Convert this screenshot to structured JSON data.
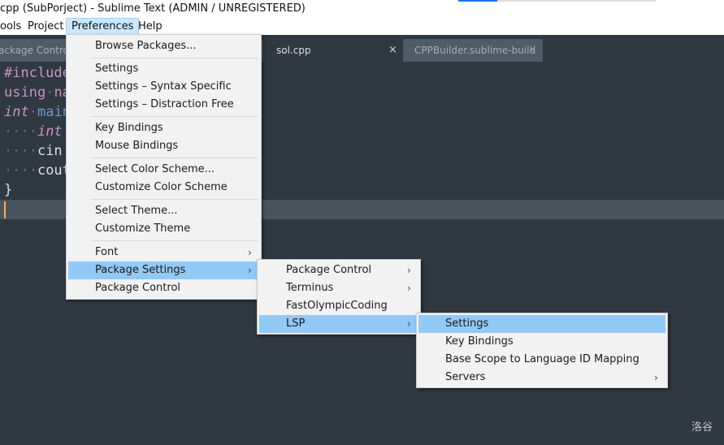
{
  "window": {
    "title": "cpp (SubPorject) - Sublime Text (ADMIN / UNREGISTERED)"
  },
  "menubar": {
    "items": [
      "ools",
      "Project",
      "Preferences",
      "Help"
    ]
  },
  "tabs": [
    {
      "label": "ackage Control M",
      "active": false
    },
    {
      "label": "sol.cpp",
      "active": true,
      "close": "×"
    },
    {
      "label": "CPPBuilder.sublime-build",
      "active": false,
      "close": "×"
    }
  ],
  "editor": {
    "lines": [
      {
        "parts": [
          {
            "t": "#include",
            "c": "kw-preproc"
          }
        ]
      },
      {
        "parts": [
          {
            "t": "using",
            "c": "kw"
          },
          {
            "t": "·",
            "c": "ws-dots"
          },
          {
            "t": "na",
            "c": "kw"
          }
        ]
      },
      {
        "parts": [
          {
            "t": "int",
            "c": "type-italic"
          },
          {
            "t": "·",
            "c": "ws-dots"
          },
          {
            "t": "main",
            "c": "func"
          }
        ]
      },
      {
        "parts": [
          {
            "t": "····",
            "c": "ws-dots"
          },
          {
            "t": "int",
            "c": "type-italic"
          }
        ]
      },
      {
        "parts": [
          {
            "t": "····",
            "c": "ws-dots"
          },
          {
            "t": "cin",
            "c": "ident"
          }
        ]
      },
      {
        "parts": [
          {
            "t": "····",
            "c": "ws-dots"
          },
          {
            "t": "cout",
            "c": "ident"
          }
        ]
      },
      {
        "parts": [
          {
            "t": "}",
            "c": "brace"
          }
        ]
      },
      {
        "parts": []
      }
    ]
  },
  "preferences_menu": {
    "items": [
      {
        "label": "Browse Packages..."
      },
      {
        "label": "Settings"
      },
      {
        "label": "Settings – Syntax Specific"
      },
      {
        "label": "Settings – Distraction Free"
      },
      {
        "label": "Key Bindings"
      },
      {
        "label": "Mouse Bindings"
      },
      {
        "label": "Select Color Scheme..."
      },
      {
        "label": "Customize Color Scheme"
      },
      {
        "label": "Select Theme..."
      },
      {
        "label": "Customize Theme"
      },
      {
        "label": "Font",
        "submenu": true
      },
      {
        "label": "Package Settings",
        "submenu": true,
        "highlighted": true
      },
      {
        "label": "Package Control"
      }
    ]
  },
  "package_settings_menu": {
    "items": [
      {
        "label": "Package Control",
        "submenu": true
      },
      {
        "label": "Terminus",
        "submenu": true
      },
      {
        "label": "FastOlympicCoding"
      },
      {
        "label": "LSP",
        "submenu": true,
        "highlighted": true
      }
    ]
  },
  "lsp_menu": {
    "items": [
      {
        "label": "Settings",
        "highlighted": true
      },
      {
        "label": "Key Bindings"
      },
      {
        "label": "Base Scope to Language ID Mapping"
      },
      {
        "label": "Servers",
        "submenu": true
      }
    ]
  },
  "submenu_arrow": "›",
  "watermark": "洛谷",
  "colors": {
    "background": "#303841",
    "menu_bg": "#f2f2f2",
    "menu_highlight": "#91c9f7",
    "keyword": "#c594c5",
    "function": "#6699cc",
    "identifier": "#d8dee9"
  }
}
